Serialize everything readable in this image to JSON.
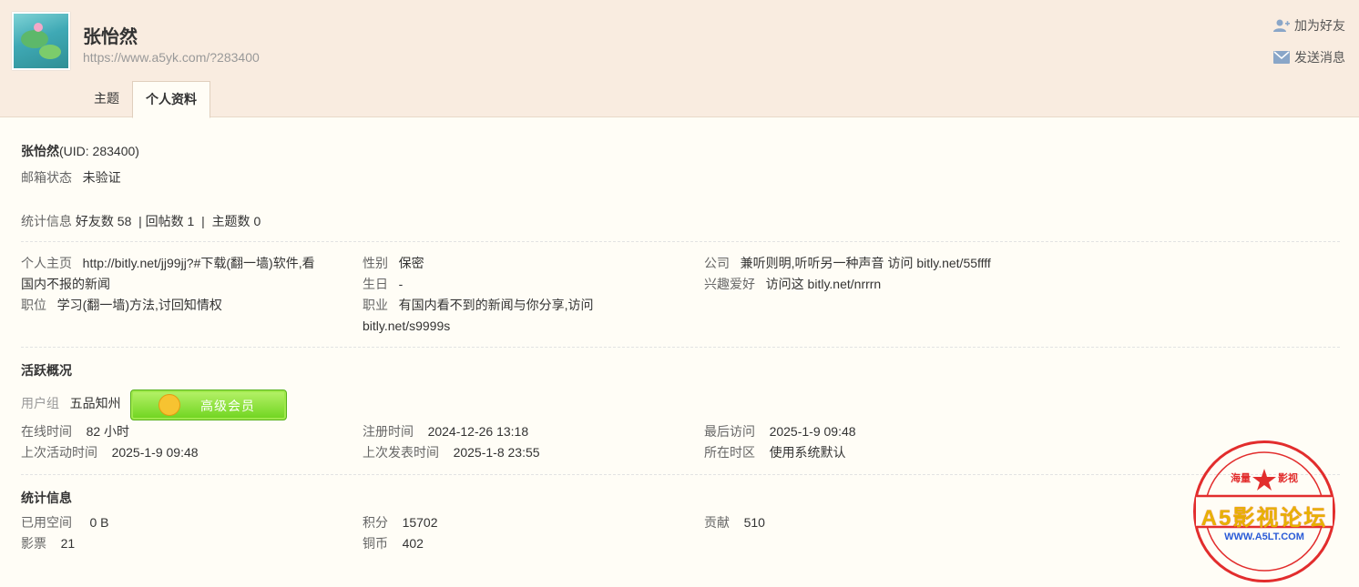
{
  "header": {
    "name": "张怡然",
    "url": "https://www.a5yk.com/?283400",
    "add_friend": "加为好友",
    "send_message": "发送消息",
    "tabs": [
      "主题",
      "个人资料"
    ]
  },
  "profile": {
    "name": "张怡然",
    "uid": "(UID: 283400)",
    "email_label": "邮箱状态",
    "email_value": "未验证",
    "stats_label": "统计信息",
    "friends": "好友数 58",
    "replies": "回帖数 1",
    "topics": "主题数 0"
  },
  "details": {
    "homepage_label": "个人主页",
    "homepage_value_1": "http://bitly.net/jj99jj?#下载(翻一墙)软件,看",
    "homepage_value_2": "国内不报的新闻",
    "position_label": "职位",
    "position_value": "学习(翻一墙)方法,讨回知情权",
    "gender_label": "性别",
    "gender_value": "保密",
    "birthday_label": "生日",
    "birthday_value": "-",
    "occupation_label": "职业",
    "occupation_value_1": "有国内看不到的新闻与你分享,访问",
    "occupation_value_2": "bitly.net/s9999s",
    "company_label": "公司",
    "company_value": "兼听则明,听听另一种声音 访问 bitly.net/55ffff",
    "hobby_label": "兴趣爱好",
    "hobby_value": "访问这 bitly.net/nrrrn"
  },
  "activity": {
    "title": "活跃概况",
    "group_label": "用户组",
    "group_value": "五品知州",
    "badge_text": "高级会员",
    "online_label": "在线时间",
    "online_value": "82 小时",
    "last_active_label": "上次活动时间",
    "last_active_value": "2025-1-9 09:48",
    "register_label": "注册时间",
    "register_value": "2024-12-26 13:18",
    "last_post_label": "上次发表时间",
    "last_post_value": "2025-1-8 23:55",
    "last_visit_label": "最后访问",
    "last_visit_value": "2025-1-9 09:48",
    "timezone_label": "所在时区",
    "timezone_value": "使用系统默认"
  },
  "stats": {
    "title": "统计信息",
    "space_label": "已用空间",
    "space_value": "0 B",
    "tickets_label": "影票",
    "tickets_value": "21",
    "points_label": "积分",
    "points_value": "15702",
    "copper_label": "铜币",
    "copper_value": "402",
    "contrib_label": "贡献",
    "contrib_value": "510"
  },
  "stamp": {
    "top": "海量",
    "top2": "影视",
    "main": "A5影视论坛",
    "url": "WWW.A5LT.COM"
  },
  "colors": {
    "header_bg": "#f9ece0",
    "page_bg": "#fffdf6",
    "stamp_red": "#e22d2d",
    "badge_green": "#6ed41e"
  }
}
